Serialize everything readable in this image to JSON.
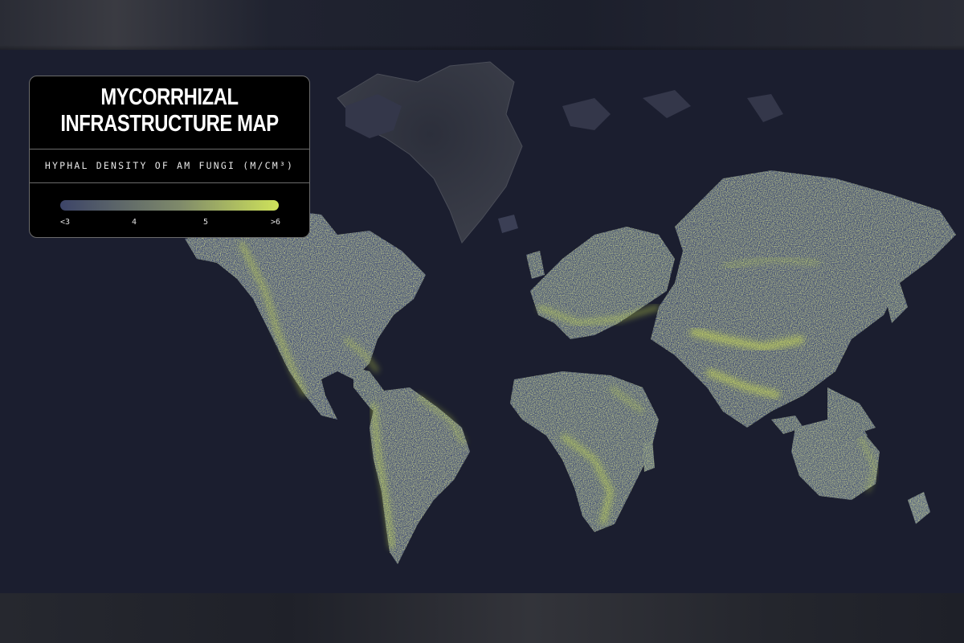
{
  "legend": {
    "title_line1": "MYCORRHIZAL",
    "title_line2": "INFRASTRUCTURE MAP",
    "subtitle": "HYPHAL DENSITY OF AM FUNGI (M/CM³)",
    "ticks": [
      "<3",
      "4",
      "5",
      ">6"
    ],
    "ramp_colors": [
      "#3c4468",
      "#cfe35a"
    ]
  },
  "colors": {
    "background": "#1b1e2f",
    "land_low": "#4a5577",
    "land_high": "#c8dd4e",
    "ice": "#2b2e3b"
  },
  "icons": [
    "world-map"
  ]
}
